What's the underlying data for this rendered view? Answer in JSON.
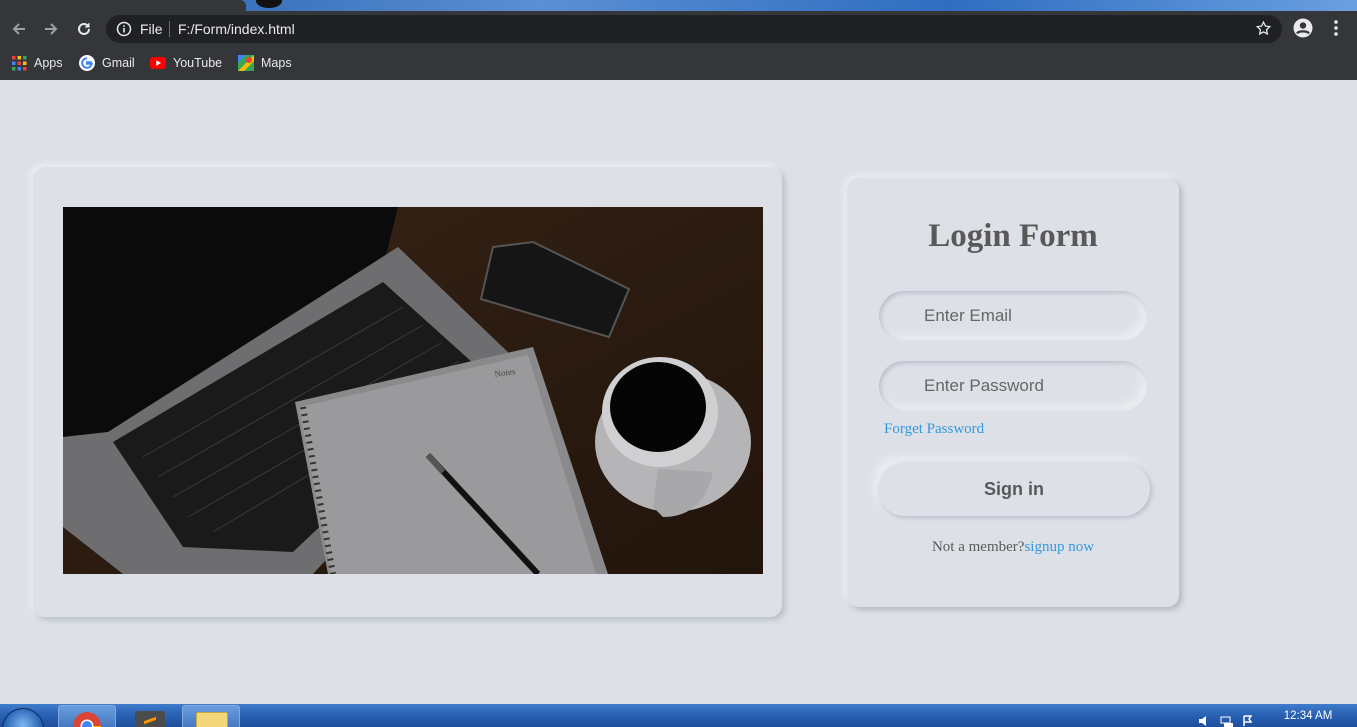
{
  "browser": {
    "omnibox": {
      "scheme_label": "File",
      "url": "F:/Form/index.html"
    },
    "bookmarks": [
      {
        "label": "Apps",
        "icon": "apps-grid-icon"
      },
      {
        "label": "Gmail",
        "icon": "google-g-icon"
      },
      {
        "label": "YouTube",
        "icon": "youtube-icon"
      },
      {
        "label": "Maps",
        "icon": "maps-icon"
      }
    ]
  },
  "login": {
    "title": "Login Form",
    "email_placeholder": "Enter Email",
    "password_placeholder": "Enter Password",
    "forget_label": "Forget Password",
    "signin_label": "Sign in",
    "signup_prompt": "Not a member?",
    "signup_link": "signup now"
  },
  "photo": {
    "notebook_label": "Notes"
  },
  "taskbar": {
    "clock_time": "12:34 AM"
  },
  "colors": {
    "background": "#dde1e7",
    "text": "#595959",
    "link": "#3498db",
    "chrome": "#35363a"
  }
}
